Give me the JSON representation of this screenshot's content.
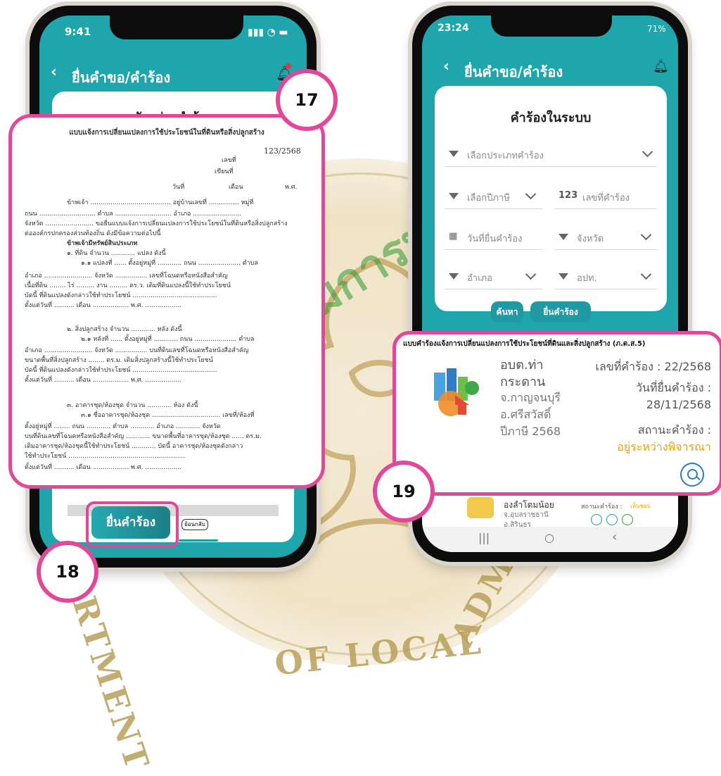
{
  "watermark": {
    "thai_text": "กรมส่งเสริมการปกครองท้องถิ่น",
    "en_text_left": "DEPARTMENT",
    "en_text_bottom": "OF LOCAL",
    "en_text_right": "ADMINISTRATION"
  },
  "left_phone": {
    "status_time": "9:41",
    "title": "ยื่นคำขอ/คำร้อง",
    "card_title": "ตัวอย่างคำร้อง",
    "doc": {
      "heading": "แบบแจ้งการเปลี่ยนแปลงการใช้ประโยชน์ในที่ดินหรือสิ่งปลูกสร้าง",
      "number": "123/2568",
      "label_write_no": "เลขที่",
      "label_write_at": "เขียนที่",
      "label_date": "วันที่",
      "label_month": "เดือน",
      "label_year": "พ.ศ.",
      "line_1": "ข้าพเจ้า ........................................ อยู่บ้านเลขที่ ............... หมู่ที่",
      "line_2": "ถนน ............................ ตำบล ............................ อำเภอ ........................",
      "line_3": "จังหวัด ........................ ขอยื่นแบบแจ้งการเปลี่ยนแปลงการใช้ประโยชน์ในที่ดินหรือสิ่งปลูกสร้าง",
      "line_4": "ต่อองค์กรปกครองส่วนท้องถิ่น ดังมีข้อความต่อไปนี้",
      "line_5": "ข้าพเจ้ามีทรัพย์สินประเภท",
      "line_6": "๑. ที่ดิน จำนวน ............ แปลง ดังนี้",
      "line_7": "๑.๑ แปลงที่ ...... ตั้งอยู่หมู่ที่ ............ ถนน ..................... ตำบล",
      "line_8": "อำเภอ ........................ จังหวัด ................ เลขที่โฉนดหรือหนังสือสำคัญ",
      "line_9": "เนื้อที่ดิน ........ ไร่ ......... งาน ......... ตร.ว. เดิมที่ดินแปลงนี้ใช้ทำประโยชน์",
      "line_10": "บัดนี้ ที่ดินแปลงดังกล่าวใช้ทำประโยชน์ ..........................................",
      "line_11": "ตั้งแต่วันที่ .......... เดือน .................. พ.ศ. ..................",
      "line_12": "๒. สิ่งปลูกสร้าง จำนวน ............ หลัง ดังนี้",
      "line_13": "๒.๑ หลังที่ ...... ตั้งอยู่หมู่ที่ ............ ถนน ..................... ตำบล",
      "line_14": "อำเภอ ........................ จังหวัด ................ บนที่ดินเลขที่โฉนดหรือหนังสือสำคัญ",
      "line_15": "ขนาดพื้นที่สิ่งปลูกสร้าง ........ ตร.ม. เดิมสิ่งปลูกสร้างนี้ใช้ทำประโยชน์",
      "line_16": "บัดนี้ ที่ดินแปลงดังกล่าวใช้ทำประโยชน์ ..........................................",
      "line_17": "ตั้งแต่วันที่ .......... เดือน .................. พ.ศ. ..................",
      "line_18": "๓. อาคารชุด/ห้องชุด จำนวน ............ ห้อง ดังนี้",
      "line_19": "๓.๑ ชื่ออาคารชุด/ห้องชุด .................................. เลขที่/ห้องที่",
      "line_20": "ตั้งอยู่หมู่ที่ ........ ถนน ............ ตำบล ............ อำเภอ ............ จังหวัด",
      "line_21": "บนที่ดินเลขที่โฉนดหรือหนังสือสำคัญ ............ ขนาดพื้นที่อาคารชุด/ห้องชุด ...... ตร.ม.",
      "line_22": "เดิมอาคารชุด/ห้องชุดนี้ใช้ทำประโยชน์ ............ บัดนี้ อาคารชุด/ห้องชุดดังกล่าว",
      "line_23": "ใช้ทำประโยชน์ ..........................................................",
      "line_24": "ตั้งแต่วันที่ .......... เดือน .................. พ.ศ. .................."
    },
    "submit_button": "ยื่นคำร้อง",
    "back_button": "ย้อนกลับ"
  },
  "right_phone": {
    "status_time": "23:24",
    "battery": "71%",
    "title": "ยื่นคำขอ/คำร้อง",
    "card_title": "คำร้องในระบบ",
    "select_type": "เลือกประเภทคำร้อง",
    "select_year": "เลือกปีภาษี",
    "request_no_prefix": "123",
    "request_no_placeholder": "เลขที่คำร้อง",
    "date_filter": "วันที่ยื่นคำร้อง",
    "province_filter": "จังหวัด",
    "district_filter": "อำเภอ",
    "lao_filter": "อปท.",
    "search_button": "ค้นหา",
    "submit_button": "ยื่นคำร้อง",
    "next_item": {
      "org": "องลำโดมน้อย",
      "province": "จ.อุบลราชธานี",
      "district": "อ.สิรินธร",
      "status_label": "สถานะคำร้อง :",
      "status_value": "เห็นชอบ"
    }
  },
  "result_card": {
    "heading": "แบบคำร้องแจ้งการเปลี่ยนแปลงการใช้ประโยชน์ที่ดินและสิ่งปลูกสร้าง (ภ.ด.ส.5)",
    "org_line1": "อบต.ท่า",
    "org_line2": "กระดาน",
    "province": "จ.กาญจนบุรี",
    "district": "อ.ศรีสวัสดิ์",
    "tax_year": "ปีภาษี 2568",
    "request_no_label": "เลขที่คำร้อง : 22/2568",
    "date_label": "วันที่ยื่นคำร้อง :",
    "date_value": "28/11/2568",
    "status_label": "สถานะคำร้อง :",
    "status_value": "อยู่ระหว่างพิจารณา",
    "colors": {
      "status": "#f0a000",
      "accent": "#1f9aa3",
      "highlight": "#e4479a"
    }
  },
  "badges": {
    "b17": "17",
    "b18": "18",
    "b19": "19"
  }
}
